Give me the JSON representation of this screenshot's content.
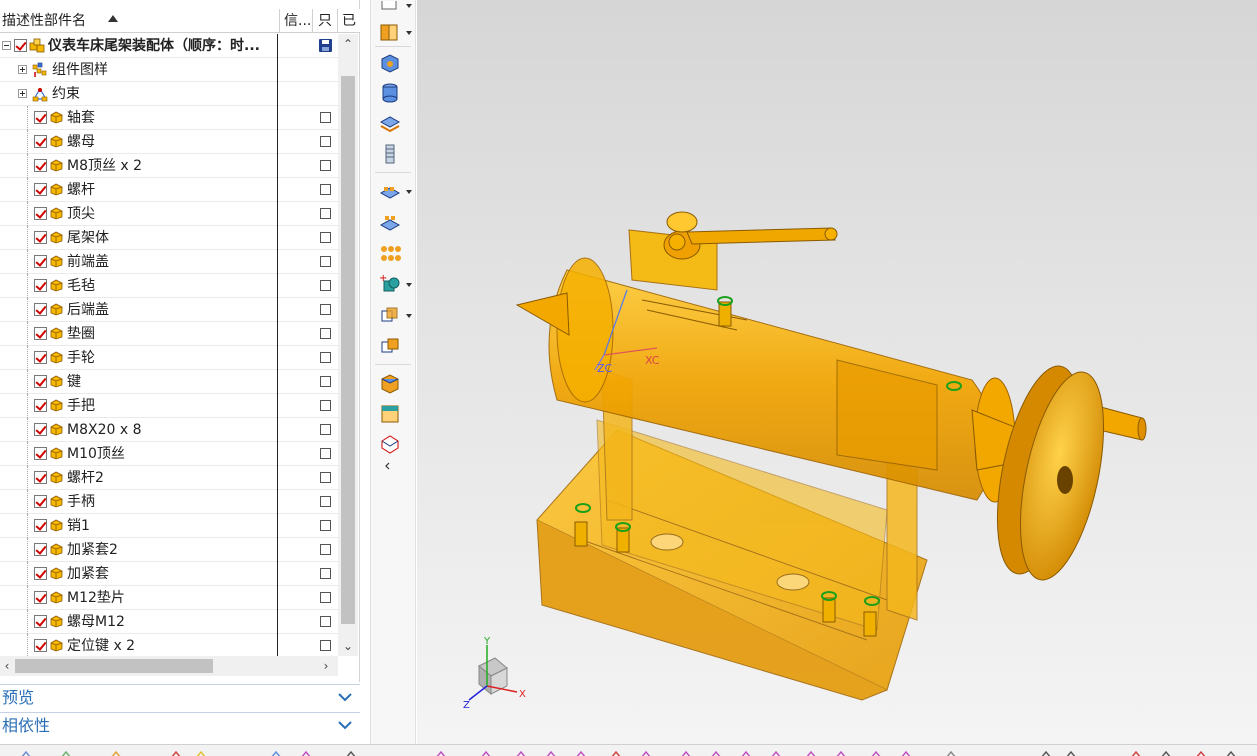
{
  "navigator": {
    "columns": {
      "name": "描述性部件名",
      "info": "信...",
      "readonly": "只",
      "modified": "已"
    },
    "root": {
      "label": "仪表车床尾架装配体（顺序：时..."
    },
    "groups": [
      {
        "label": "组件图样",
        "icon": "drawing-pattern-icon"
      },
      {
        "label": "约束",
        "icon": "constraints-icon"
      }
    ],
    "parts": [
      {
        "label": "轴套"
      },
      {
        "label": "螺母"
      },
      {
        "label": "M8顶丝 x 2"
      },
      {
        "label": "螺杆"
      },
      {
        "label": "顶尖"
      },
      {
        "label": "尾架体"
      },
      {
        "label": "前端盖"
      },
      {
        "label": "毛毡"
      },
      {
        "label": "后端盖"
      },
      {
        "label": "垫圈"
      },
      {
        "label": "手轮"
      },
      {
        "label": "键"
      },
      {
        "label": "手把"
      },
      {
        "label": "M8X20 x 8"
      },
      {
        "label": "M10顶丝"
      },
      {
        "label": "螺杆2"
      },
      {
        "label": "手柄"
      },
      {
        "label": "销1"
      },
      {
        "label": "加紧套2"
      },
      {
        "label": "加紧套"
      },
      {
        "label": "M12垫片"
      },
      {
        "label": "螺母M12"
      },
      {
        "label": "定位键 x 2"
      }
    ]
  },
  "panels": {
    "preview": "预览",
    "dependencies": "相依性"
  },
  "viewport": {
    "csys_labels": {
      "xc": "XC",
      "zc": "ZC"
    },
    "triad": {
      "x": "X",
      "y": "Y",
      "z": "Z"
    }
  },
  "colors": {
    "model": "#f2a900",
    "panel_text": "#2b6fb6",
    "check": "#d10000"
  }
}
